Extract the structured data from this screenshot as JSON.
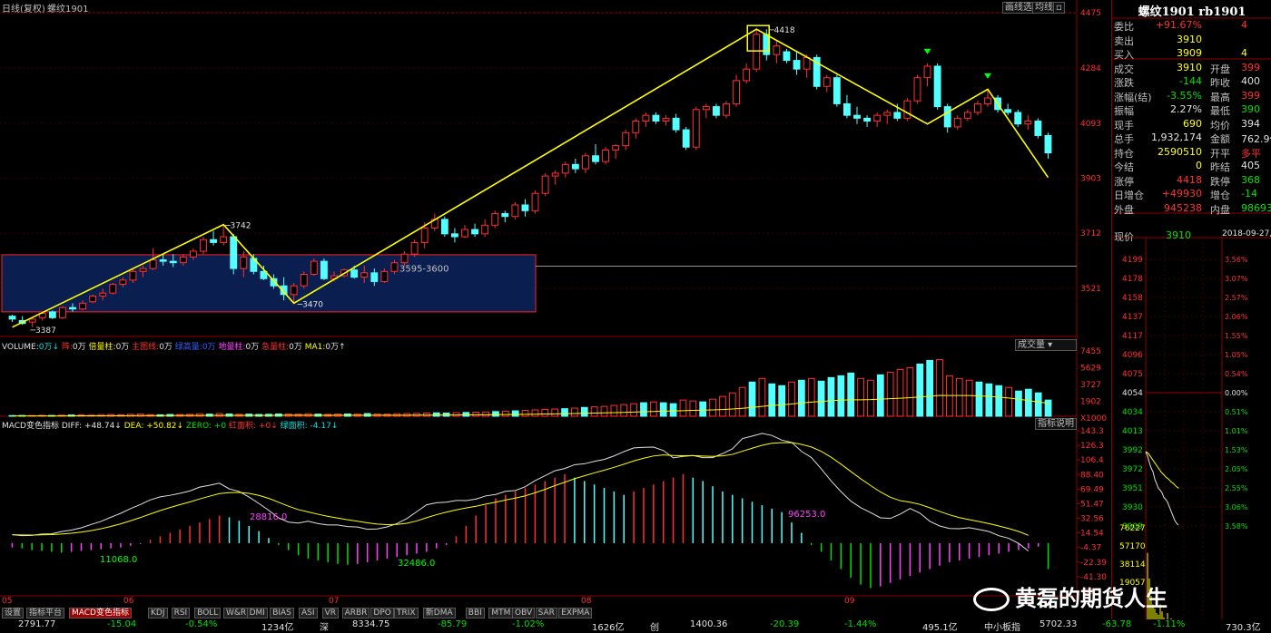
{
  "window": {
    "period_label": "日线(复权)",
    "symbol_label": "螺纹1901",
    "buttons": [
      "画线选",
      "均线",
      "▫"
    ]
  },
  "colors": {
    "up": "#ff3030",
    "down": "#54ffff",
    "avgline": "#ffff00",
    "zigzag": "#ffff00",
    "zone_fill": "#0a1e50",
    "zone_border": "#ff2020"
  },
  "chart_data": [
    {
      "type": "candlestick",
      "name": "螺纹1901 daily",
      "ylim": [
        3355,
        4475
      ],
      "y_ticks": [
        4475,
        4284,
        4093,
        3903,
        3712,
        3521
      ],
      "x_ticks": [
        "05",
        "06",
        "07",
        "08",
        "09"
      ],
      "candles": [
        [
          3425,
          3430,
          3405,
          3415
        ],
        [
          3410,
          3425,
          3395,
          3400
        ],
        [
          3405,
          3420,
          3387,
          3415
        ],
        [
          3420,
          3440,
          3410,
          3435
        ],
        [
          3440,
          3445,
          3415,
          3420
        ],
        [
          3420,
          3460,
          3415,
          3455
        ],
        [
          3455,
          3470,
          3440,
          3450
        ],
        [
          3450,
          3480,
          3445,
          3470
        ],
        [
          3475,
          3500,
          3470,
          3495
        ],
        [
          3495,
          3520,
          3480,
          3505
        ],
        [
          3505,
          3540,
          3500,
          3535
        ],
        [
          3535,
          3560,
          3525,
          3550
        ],
        [
          3550,
          3590,
          3540,
          3580
        ],
        [
          3580,
          3600,
          3560,
          3590
        ],
        [
          3590,
          3660,
          3585,
          3620
        ],
        [
          3620,
          3640,
          3600,
          3615
        ],
        [
          3615,
          3640,
          3595,
          3610
        ],
        [
          3610,
          3640,
          3600,
          3630
        ],
        [
          3630,
          3660,
          3620,
          3650
        ],
        [
          3650,
          3700,
          3640,
          3690
        ],
        [
          3690,
          3720,
          3670,
          3680
        ],
        [
          3680,
          3742,
          3670,
          3700
        ],
        [
          3700,
          3710,
          3570,
          3590
        ],
        [
          3590,
          3650,
          3560,
          3630
        ],
        [
          3625,
          3640,
          3570,
          3580
        ],
        [
          3580,
          3600,
          3550,
          3555
        ],
        [
          3555,
          3570,
          3520,
          3530
        ],
        [
          3530,
          3560,
          3480,
          3500
        ],
        [
          3500,
          3540,
          3470,
          3530
        ],
        [
          3530,
          3580,
          3520,
          3570
        ],
        [
          3570,
          3625,
          3565,
          3615
        ],
        [
          3615,
          3625,
          3550,
          3555
        ],
        [
          3555,
          3580,
          3545,
          3565
        ],
        [
          3565,
          3590,
          3560,
          3585
        ],
        [
          3585,
          3600,
          3555,
          3560
        ],
        [
          3560,
          3600,
          3540,
          3575
        ],
        [
          3575,
          3590,
          3530,
          3545
        ],
        [
          3545,
          3590,
          3540,
          3580
        ],
        [
          3580,
          3620,
          3570,
          3610
        ],
        [
          3610,
          3650,
          3600,
          3640
        ],
        [
          3640,
          3690,
          3630,
          3680
        ],
        [
          3680,
          3750,
          3660,
          3730
        ],
        [
          3730,
          3780,
          3720,
          3760
        ],
        [
          3760,
          3770,
          3700,
          3710
        ],
        [
          3710,
          3730,
          3680,
          3700
        ],
        [
          3700,
          3740,
          3695,
          3725
        ],
        [
          3725,
          3745,
          3700,
          3710
        ],
        [
          3710,
          3760,
          3700,
          3740
        ],
        [
          3740,
          3790,
          3730,
          3780
        ],
        [
          3780,
          3790,
          3750,
          3770
        ],
        [
          3770,
          3820,
          3760,
          3810
        ],
        [
          3810,
          3830,
          3770,
          3790
        ],
        [
          3790,
          3860,
          3780,
          3850
        ],
        [
          3850,
          3920,
          3840,
          3910
        ],
        [
          3910,
          3930,
          3880,
          3920
        ],
        [
          3920,
          3960,
          3905,
          3950
        ],
        [
          3950,
          3970,
          3920,
          3935
        ],
        [
          3935,
          3990,
          3920,
          3980
        ],
        [
          3980,
          4020,
          3950,
          3960
        ],
        [
          3960,
          4010,
          3950,
          4000
        ],
        [
          4000,
          4020,
          3970,
          4015
        ],
        [
          4015,
          4070,
          4000,
          4060
        ],
        [
          4060,
          4110,
          4040,
          4100
        ],
        [
          4100,
          4130,
          4080,
          4120
        ],
        [
          4120,
          4130,
          4090,
          4100
        ],
        [
          4100,
          4120,
          4085,
          4110
        ],
        [
          4110,
          4125,
          4060,
          4070
        ],
        [
          4070,
          4080,
          4000,
          4010
        ],
        [
          4010,
          4150,
          4000,
          4140
        ],
        [
          4140,
          4160,
          4110,
          4150
        ],
        [
          4150,
          4160,
          4110,
          4120
        ],
        [
          4120,
          4170,
          4110,
          4160
        ],
        [
          4160,
          4260,
          4150,
          4240
        ],
        [
          4240,
          4300,
          4230,
          4280
        ],
        [
          4280,
          4418,
          4270,
          4400
        ],
        [
          4400,
          4418,
          4310,
          4330
        ],
        [
          4330,
          4380,
          4300,
          4360
        ],
        [
          4340,
          4350,
          4300,
          4310
        ],
        [
          4310,
          4340,
          4260,
          4280
        ],
        [
          4280,
          4330,
          4250,
          4320
        ],
        [
          4320,
          4330,
          4210,
          4220
        ],
        [
          4220,
          4260,
          4200,
          4250
        ],
        [
          4250,
          4260,
          4150,
          4160
        ],
        [
          4160,
          4190,
          4110,
          4120
        ],
        [
          4120,
          4150,
          4090,
          4110
        ],
        [
          4110,
          4120,
          4080,
          4100
        ],
        [
          4100,
          4130,
          4080,
          4120
        ],
        [
          4120,
          4140,
          4090,
          4130
        ],
        [
          4130,
          4160,
          4100,
          4110
        ],
        [
          4110,
          4180,
          4100,
          4170
        ],
        [
          4170,
          4260,
          4160,
          4250
        ],
        [
          4250,
          4300,
          4220,
          4290
        ],
        [
          4290,
          4300,
          4140,
          4150
        ],
        [
          4150,
          4160,
          4060,
          4080
        ],
        [
          4080,
          4120,
          4070,
          4110
        ],
        [
          4110,
          4140,
          4100,
          4130
        ],
        [
          4130,
          4170,
          4120,
          4160
        ],
        [
          4160,
          4210,
          4150,
          4180
        ],
        [
          4180,
          4190,
          4130,
          4140
        ],
        [
          4140,
          4160,
          4120,
          4130
        ],
        [
          4130,
          4140,
          4080,
          4090
        ],
        [
          4090,
          4120,
          4070,
          4100
        ],
        [
          4100,
          4110,
          4040,
          4050
        ],
        [
          4050,
          4060,
          3970,
          3990
        ]
      ],
      "annotations": {
        "high": "4418",
        "h2": "3742",
        "low1": "3387",
        "low2": "3470",
        "zone": "3595-3600"
      }
    },
    {
      "type": "bar",
      "name": "VOLUME",
      "ylim": [
        0,
        7455
      ],
      "y_ticks": [
        "7455",
        "5629",
        "3727",
        "1902",
        "X1000"
      ],
      "values": [
        80,
        90,
        80,
        100,
        90,
        120,
        140,
        150,
        130,
        180,
        200,
        160,
        220,
        250,
        180,
        160,
        200,
        190,
        220,
        280,
        240,
        300,
        260,
        220,
        240,
        200,
        220,
        260,
        250,
        230,
        280,
        240,
        220,
        250,
        260,
        240,
        300,
        260,
        240,
        280,
        300,
        320,
        350,
        380,
        360,
        400,
        420,
        450,
        480,
        520,
        560,
        600,
        650,
        700,
        760,
        800,
        840,
        900,
        980,
        1050,
        1100,
        1200,
        1300,
        1400,
        1500,
        1600,
        1500,
        1400,
        1800,
        1700,
        1600,
        1900,
        2200,
        2600,
        3200,
        3800,
        4200,
        3600,
        3400,
        3800,
        4000,
        4200,
        3900,
        4300,
        4500,
        4800,
        4200,
        4000,
        4600,
        4900,
        5200,
        5400,
        5800,
        6200,
        6300,
        4500,
        4200,
        4000,
        3800,
        3600,
        3400,
        3200,
        2800,
        3000,
        2600,
        1800
      ],
      "labels": [
        "VOLUME:",
        "0万↓",
        "阵:",
        "0万",
        "倍量柱:",
        "0万",
        "主图线:",
        "0万",
        "绿高量:",
        "0万",
        "地量柱:",
        "0万",
        "急量柱:",
        "0万",
        "MA1:",
        "0万↑"
      ],
      "dropdown": "成交量"
    },
    {
      "type": "bar",
      "name": "MACD变色指标",
      "ylim": [
        -61.31,
        143.3
      ],
      "y_ticks": [
        "143.3",
        "126.3",
        "106.4",
        "88.40",
        "69.49",
        "51.47",
        "32.56",
        "14.54",
        "-4.37",
        "-22.39",
        "-41.30",
        "-59.3"
      ],
      "header": {
        "name": "MACD变色指标",
        "diff": "DIFF: +48.74↓",
        "dea": "DEA: +50.82↓",
        "zero": "ZERO: +0",
        "hongmj": "红面积: +0↓",
        "lvmj": "绿面积: -4.17↓"
      },
      "values": [
        -5,
        -6,
        -8,
        -9,
        -10,
        -11,
        -10,
        -9,
        -8,
        -7,
        -6,
        -5,
        -3,
        -1,
        2,
        4,
        6,
        8,
        10,
        12,
        14,
        16,
        15,
        13,
        10,
        7,
        3,
        -2,
        -8,
        -14,
        -18,
        -20,
        -22,
        -24,
        -25,
        -24,
        -22,
        -20,
        -18,
        -16,
        -14,
        -12,
        -10,
        -6,
        -2,
        4,
        10,
        16,
        22,
        26,
        28,
        30,
        32,
        34,
        36,
        38,
        40,
        38,
        36,
        34,
        32,
        30,
        28,
        30,
        32,
        34,
        36,
        38,
        40,
        38,
        36,
        33,
        30,
        28,
        26,
        24,
        22,
        20,
        18,
        12,
        6,
        -2,
        -10,
        -20,
        -30,
        -40,
        -48,
        -52,
        -50,
        -46,
        -42,
        -38,
        -34,
        -30,
        -26,
        -22,
        -20,
        -18,
        -16,
        -14,
        -12,
        -10,
        -8,
        -6,
        -4,
        -30
      ],
      "annotations": [
        "28816.0",
        "11068.0",
        "32486.0",
        "96253.0"
      ],
      "button": "指标说明"
    },
    {
      "type": "line",
      "name": "分时",
      "ylim": [
        3890,
        4199
      ],
      "y_ticks": [
        "4199",
        "4178",
        "4158",
        "4137",
        "4117",
        "4096",
        "4075",
        "4054",
        "4034",
        "4013",
        "3992",
        "3972",
        "3951",
        "3930",
        "3909"
      ],
      "pct_ticks": [
        "3.56%",
        "3.07%",
        "2.57%",
        "2.06%",
        "1.55%",
        "1.05%",
        "0.54%",
        "0.00%",
        "0.51%",
        "1.01%",
        "1.53%",
        "2.05%",
        "2.55%",
        "3.06%",
        "3.58%"
      ],
      "vol_ticks": [
        "76227",
        "57170",
        "38114",
        "19057"
      ],
      "price": [
        3990,
        3985,
        3978,
        3972,
        3968,
        3960,
        3955,
        3950,
        3948,
        3945,
        3940,
        3938,
        3935,
        3930,
        3925,
        3920,
        3915,
        3912,
        3910
      ],
      "avg": [
        3990,
        3988,
        3984,
        3980,
        3976,
        3972,
        3968,
        3965,
        3962,
        3960,
        3957,
        3955,
        3952,
        3950
      ]
    }
  ],
  "quote": {
    "title": "螺纹1901 rb1901",
    "rows": [
      {
        "l": "委比",
        "v": "+91.67%",
        "vc": "red",
        "l2": "",
        "v2": "4",
        "v2c": "red"
      },
      {
        "l": "卖出",
        "v": "3910",
        "vc": "yel",
        "l2": "",
        "v2": "",
        "v2c": "wht"
      },
      {
        "l": "买入",
        "v": "3909",
        "vc": "yel",
        "l2": "",
        "v2": "4",
        "v2c": "yel"
      },
      {
        "l": "成交",
        "v": "3910",
        "vc": "yel",
        "l2": "开盘",
        "v2": "399",
        "v2c": "red"
      },
      {
        "l": "涨跌",
        "v": "-144",
        "vc": "green",
        "l2": "昨收",
        "v2": "400",
        "v2c": "wht"
      },
      {
        "l": "涨幅(结)",
        "v": "-3.55%",
        "vc": "green",
        "l2": "最高",
        "v2": "399",
        "v2c": "red"
      },
      {
        "l": "振幅",
        "v": "2.27%",
        "vc": "wht",
        "l2": "最低",
        "v2": "390",
        "v2c": "green"
      },
      {
        "l": "现手",
        "v": "690",
        "vc": "yel",
        "l2": "均价",
        "v2": "394",
        "v2c": "wht"
      },
      {
        "l": "总手",
        "v": "1,932,174",
        "vc": "wht",
        "l2": "金额",
        "v2": "762.9亿",
        "v2c": "wht"
      },
      {
        "l": "持仓",
        "v": "2590510",
        "vc": "yel",
        "l2": "开平",
        "v2": "多平",
        "v2c": "red"
      },
      {
        "l": "今结",
        "v": "0",
        "vc": "yel",
        "l2": "昨结",
        "v2": "405",
        "v2c": "wht"
      },
      {
        "l": "涨停",
        "v": "4418",
        "vc": "red",
        "l2": "跌停",
        "v2": "368",
        "v2c": "green"
      },
      {
        "l": "日增仓",
        "v": "+49930",
        "vc": "red",
        "l2": "增仓",
        "v2": "-14",
        "v2c": "green"
      },
      {
        "l": "外盘",
        "v": "945238",
        "vc": "red",
        "l2": "内盘",
        "v2": "98693",
        "v2c": "green"
      }
    ],
    "now_label": "现价",
    "now_value": "3910",
    "now_date": "2018-09-27,"
  },
  "tabs": [
    "设置",
    "指标平台",
    "MACD变色指标",
    "KDJ",
    "RSI",
    "BOLL",
    "W&R",
    "DMI",
    "BIAS",
    "ASI",
    "VR",
    "ARBR",
    "DPO",
    "TRIX",
    "新DMA",
    "BBI",
    "MTM",
    "OBV",
    "SAR",
    "EXPMA"
  ],
  "status": [
    {
      "t": "2791.77",
      "c": "wht"
    },
    {
      "t": "-15.04",
      "c": "green"
    },
    {
      "t": "-0.54%",
      "c": "green"
    },
    {
      "t": "1234亿",
      "c": "wht"
    },
    {
      "t": "深",
      "c": "wht"
    },
    {
      "t": "8334.75",
      "c": "wht"
    },
    {
      "t": "-85.79",
      "c": "green"
    },
    {
      "t": "-1.02%",
      "c": "green"
    },
    {
      "t": "1626亿",
      "c": "wht"
    },
    {
      "t": "创",
      "c": "wht"
    },
    {
      "t": "1400.36",
      "c": "wht"
    },
    {
      "t": "-20.39",
      "c": "green"
    },
    {
      "t": "-1.44%",
      "c": "green"
    },
    {
      "t": "495.1亿",
      "c": "wht"
    },
    {
      "t": "中小板指",
      "c": "wht"
    },
    {
      "t": "5702.33",
      "c": "wht"
    },
    {
      "t": "-63.78",
      "c": "green"
    },
    {
      "t": "-1.11%",
      "c": "green"
    },
    {
      "t": "730.3亿",
      "c": "wht"
    }
  ],
  "watermark": "黄磊的期货人生"
}
